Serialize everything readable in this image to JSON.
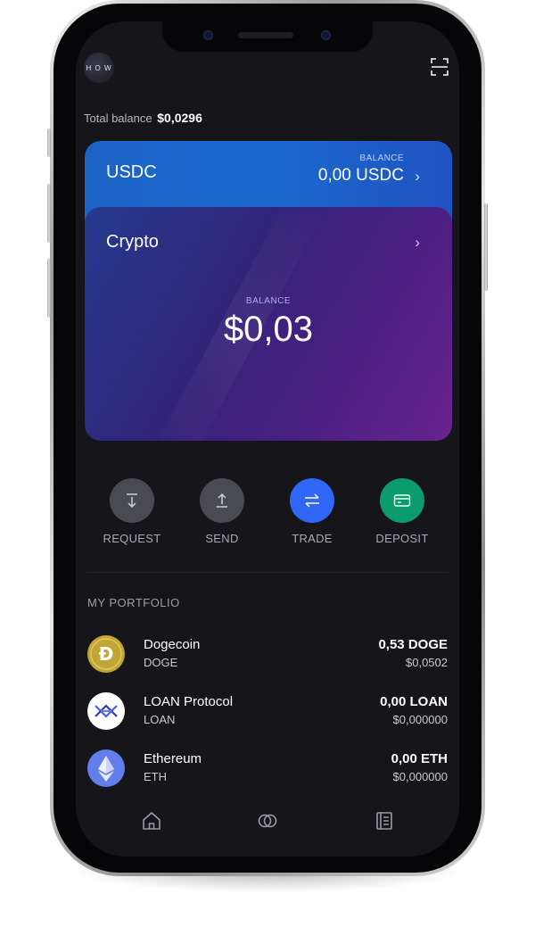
{
  "header": {
    "avatar_text": "H O W",
    "scan_icon": "qr-scan-icon",
    "total_balance_label": "Total balance",
    "total_balance_value": "$0,0296"
  },
  "cards": {
    "usdc": {
      "name": "USDC",
      "balance_label": "BALANCE",
      "balance_value": "0,00 USDC",
      "chevron": "›"
    },
    "crypto": {
      "name": "Crypto",
      "balance_label": "BALANCE",
      "balance_value": "$0,03",
      "chevron": "›"
    }
  },
  "actions": [
    {
      "label": "REQUEST",
      "icon": "arrow-down-icon",
      "color": "#4a4a52"
    },
    {
      "label": "SEND",
      "icon": "arrow-up-icon",
      "color": "#4a4a52"
    },
    {
      "label": "TRADE",
      "icon": "swap-arrows-icon",
      "color": "#2f66f5"
    },
    {
      "label": "DEPOSIT",
      "icon": "card-icon",
      "color": "#0c9b6d"
    }
  ],
  "portfolio": {
    "title": "MY PORTFOLIO",
    "assets": [
      {
        "name": "Dogecoin",
        "symbol": "DOGE",
        "amount": "0,53 DOGE",
        "fiat": "$0,0502",
        "icon": "dogecoin-icon",
        "color": "#c2a633"
      },
      {
        "name": "LOAN Protocol",
        "symbol": "LOAN",
        "amount": "0,00 LOAN",
        "fiat": "$0,000000",
        "icon": "loan-protocol-icon",
        "color": "#ffffff"
      },
      {
        "name": "Ethereum",
        "symbol": "ETH",
        "amount": "0,00 ETH",
        "fiat": "$0,000000",
        "icon": "ethereum-icon",
        "color": "#627eea"
      }
    ]
  },
  "tabbar": {
    "items": [
      {
        "icon": "home-icon"
      },
      {
        "icon": "wallet-circles-icon"
      },
      {
        "icon": "news-icon"
      }
    ]
  }
}
